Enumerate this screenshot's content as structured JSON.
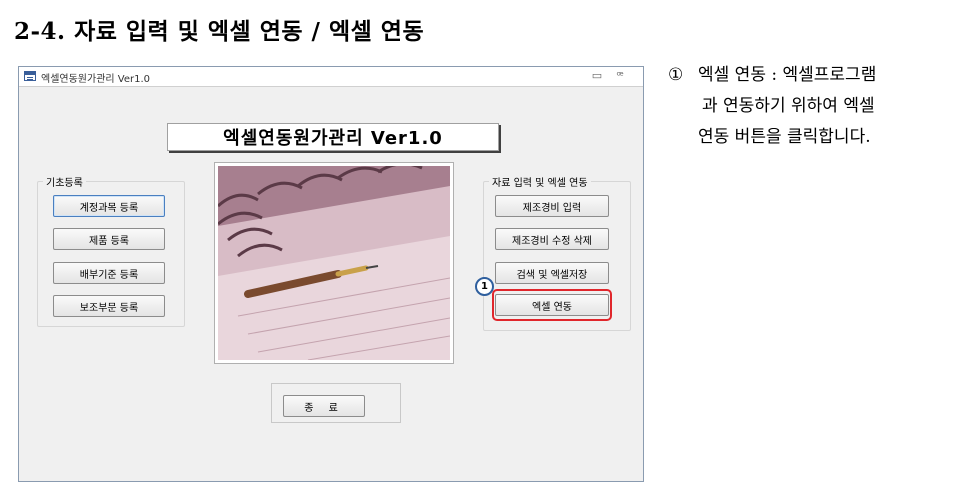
{
  "heading": "2-4. 자료 입력 및 엑셀 연동 / 엑셀 연동",
  "window": {
    "title": "엑셀연동원가관리 Ver1.0",
    "minimize_icon": "minimize-icon",
    "maximize_icon": "maximize-icon",
    "minimize_glyph": "▭",
    "maximize_glyph": "ꟹ",
    "app_heading": "엑셀연동원가관리 Ver1.0"
  },
  "left_group": {
    "label": "기초등록",
    "buttons": [
      "계정과목 등록",
      "제품 등록",
      "배부기준 등록",
      "보조부문 등록"
    ]
  },
  "right_group": {
    "label": "자료 입력 및 엑셀 연동",
    "buttons": [
      "제조경비 입력",
      "제조경비 수정 삭제",
      "검색 및 엑셀저장",
      "엑셀 연동"
    ]
  },
  "exit_button": "종 료",
  "callout_number": "1",
  "highlight_color": "#e0262b",
  "description": {
    "number": "①",
    "lines": [
      "엑셀 연동 : 엑셀프로그램",
      "과 연동하기 위하여 엑셀",
      "연동 버튼을 클릭합니다."
    ]
  }
}
